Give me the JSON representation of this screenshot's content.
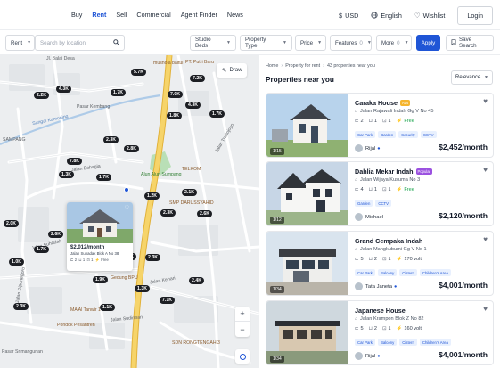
{
  "nav": {
    "links": [
      "Buy",
      "Rent",
      "Sell",
      "Commercial",
      "Agent Finder",
      "News"
    ],
    "active_index": 1,
    "currency": "USD",
    "language": "English",
    "wishlist": "Wishlist",
    "login": "Login",
    "currency_icon": "dollar-icon",
    "language_icon": "globe-icon",
    "wishlist_icon": "heart-icon"
  },
  "filters": {
    "mode": "Rent",
    "search_placeholder": "Search by location",
    "studio_beds": "Studio Beds",
    "property_type": "Property Type",
    "price": "Price",
    "features": "Features",
    "features_count": "0",
    "more": "More",
    "more_count": "0",
    "apply": "Apply",
    "save_search": "Save Search"
  },
  "map": {
    "draw": "Draw",
    "labels": [
      "Jl. Balai Desa",
      "Pasar Kembang",
      "Jalan Bahagia",
      "Alun Alun Sumpang",
      "TELKOM",
      "SMP DARUSSYAHID",
      "SAMPANG",
      "Gedung BPU",
      "Jalan Kenari",
      "MA Al Tanwir 1",
      "Pondok Pesantren",
      "SDN RONGTENGAH 3",
      "Jalan Sudirman",
      "Jalan Trunojoyo",
      "Jalan Suhadak",
      "Sungai Kamoning",
      "mushola baitul",
      "PT. Putri Baru",
      "Jalan Diponegoro",
      "Pasar Srimangunan"
    ],
    "price_pills": [
      "5.7K",
      "7.2K",
      "1.7K",
      "4.3K",
      "2.2K",
      "4.3K",
      "7.0K",
      "1.8K",
      "2.3K",
      "7.8K",
      "1.3K",
      "1.7K",
      "2.1K",
      "1.2K",
      "2.3K",
      "2.6K",
      "2.0K",
      "2.6K",
      "1.0K",
      "2.3K",
      "1.9K",
      "2.4K",
      "1.3K",
      "7.1K",
      "2.3K",
      "1.1K",
      "1.7K",
      "1.2K",
      "1.7K",
      "2.8K"
    ],
    "popup": {
      "price": "$2,012/month",
      "address": "Jalan Suhadak Blok A No 38",
      "beds": "2",
      "baths": "1",
      "cars": "1",
      "electric": "Free"
    }
  },
  "panel": {
    "breadcrumb": [
      "Home",
      "Property for rent",
      "43 properties near you"
    ],
    "title": "Properties near you",
    "sort": "Relevance",
    "listings": [
      {
        "title": "Caraka House",
        "badge": "Ads",
        "badge_color": "#f5b52e",
        "address": "Jalan Rajawali Indah Gg V No 45",
        "beds": "2",
        "baths": "1",
        "cars": "1",
        "electric": "Free",
        "tags": [
          "Car Park",
          "Garden",
          "Security",
          "CCTV"
        ],
        "agent": "Rijal",
        "price": "$2,452/month",
        "photos": "1/15"
      },
      {
        "title": "Dahlia Mekar Indah",
        "badge": "Popular",
        "badge_color": "#9b51e0",
        "address": "Jalan Wijaya Kusuma No 3",
        "beds": "4",
        "baths": "1",
        "cars": "1",
        "electric": "Free",
        "tags": [
          "Garden",
          "CCTV"
        ],
        "agent": "Michael",
        "price": "$2,120/month",
        "photos": "1/12"
      },
      {
        "title": "Grand Cempaka Indah",
        "badge": "",
        "badge_color": "",
        "address": "Jalan Mangkubumi Gg V No 1",
        "beds": "5",
        "baths": "2",
        "cars": "1",
        "electric": "170 volt",
        "tags": [
          "Car Park",
          "Balcony",
          "Cistern",
          "Children's Area"
        ],
        "agent": "Tata Janeta",
        "price": "$4,001/month",
        "photos": "1/34"
      },
      {
        "title": "Japanese House",
        "badge": "",
        "badge_color": "",
        "address": "Jalan Krampon Blok Z No 82",
        "beds": "5",
        "baths": "2",
        "cars": "1",
        "electric": "160 volt",
        "tags": [
          "Car Park",
          "Balcony",
          "Cistern",
          "Children's Area"
        ],
        "agent": "Rijal",
        "price": "$4,001/month",
        "photos": "1/34"
      }
    ]
  },
  "colors": {
    "accent": "#1f55d6",
    "road_major": "#f2c94c",
    "pill": "#1d1f24",
    "tag_bg": "#e8f0fe"
  }
}
